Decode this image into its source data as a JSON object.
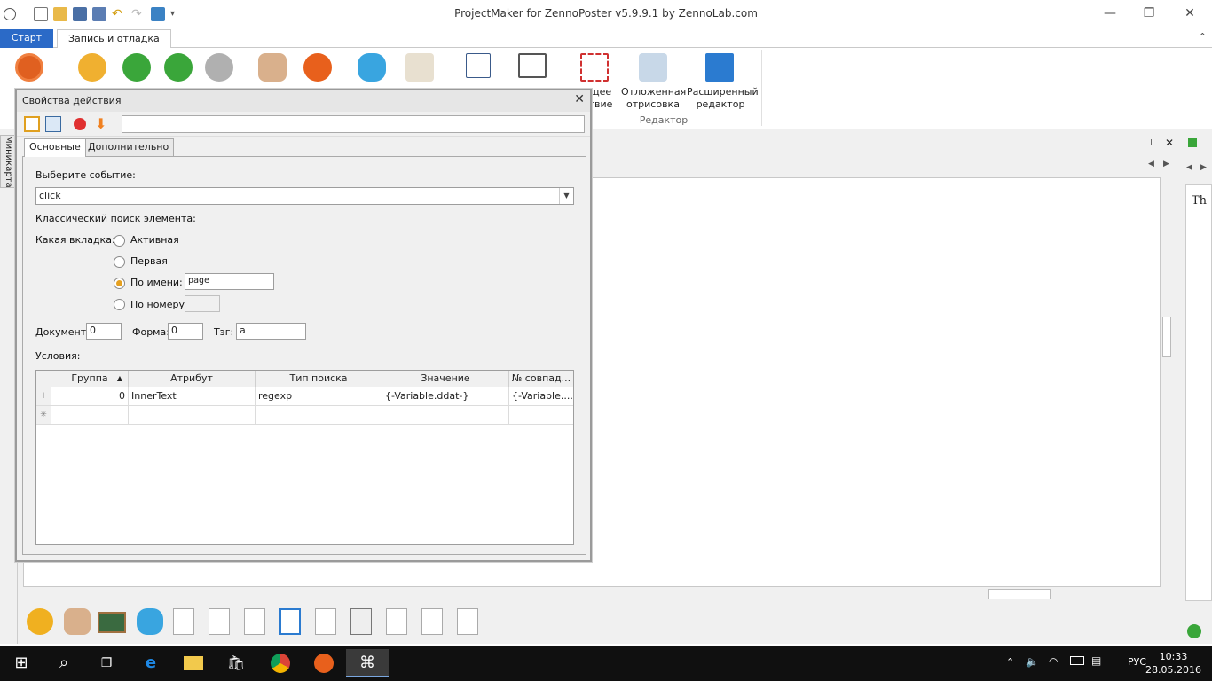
{
  "app": {
    "title": "ProjectMaker for ZennoPoster v5.9.9.1 by ZennoLab.com",
    "tabs": [
      "Старт",
      "Запись и отладка"
    ]
  },
  "ribbon": {
    "labels": {
      "partial1_line1": "ущее",
      "partial1_line2": "ствие",
      "deferred_line1": "Отложенная",
      "deferred_line2": "отрисовка",
      "extended_line1": "Расширенный",
      "extended_line2": "редактор",
      "group_editor": "Редактор"
    }
  },
  "sidebar": {
    "minimap_label": "Миникарта"
  },
  "dialog": {
    "title": "Свойства действия",
    "tabs": {
      "main": "Основные",
      "extra": "Дополнительно"
    },
    "event_label": "Выберите событие:",
    "event_value": "click",
    "classic_search_label": "Классический поиск элемента:",
    "which_tab_label": "Какая вкладка:",
    "radios": {
      "active": "Активная",
      "first": "Первая",
      "by_name": "По имени:",
      "by_number": "По номеру:"
    },
    "by_name_value": "page",
    "by_number_value": "",
    "document_label": "Документ:",
    "document_value": "0",
    "form_label": "Форма:",
    "form_value": "0",
    "tag_label": "Тэг:",
    "tag_value": "a",
    "conditions_label": "Условия:",
    "grid": {
      "headers": [
        "Группа",
        "Атрибут",
        "Тип поиска",
        "Значение",
        "№ совпад..."
      ],
      "rows": [
        {
          "group": "0",
          "attribute": "InnerText",
          "search_type": "regexp",
          "value": "{-Variable.ddat-}",
          "match": "{-Variable...."
        }
      ]
    }
  },
  "right_panel": {
    "text": "Th"
  },
  "taskbar": {
    "lang": "РУС",
    "time": "10:33",
    "date": "28.05.2016"
  },
  "colors": {
    "accent": "#2b6ac7",
    "taskbar": "#101010",
    "radio_selected": "#e5a020"
  }
}
